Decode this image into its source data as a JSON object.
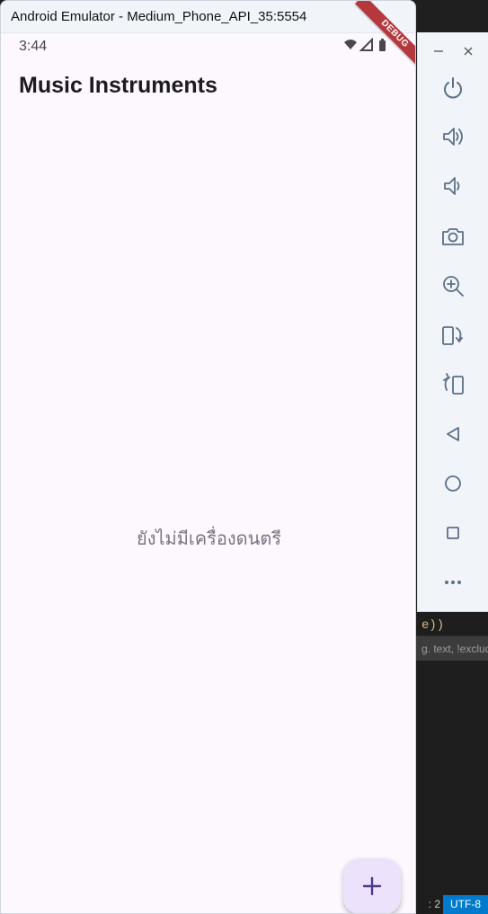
{
  "window": {
    "title": "Android Emulator - Medium_Phone_API_35:5554"
  },
  "status_bar": {
    "time": "3:44",
    "icons": [
      "wifi-icon",
      "cell-signal-icon",
      "battery-icon"
    ]
  },
  "app": {
    "title": "Music Instruments",
    "empty_message": "ยังไม่มีเครื่องดนตรี",
    "debug_banner": "DEBUG",
    "fab_icon": "add-icon"
  },
  "toolbar": {
    "window_controls": [
      "minimize-icon",
      "close-icon"
    ],
    "buttons": [
      {
        "name": "power-button",
        "icon": "power-icon"
      },
      {
        "name": "volume-up-button",
        "icon": "volume-up-icon"
      },
      {
        "name": "volume-down-button",
        "icon": "volume-down-icon"
      },
      {
        "name": "screenshot-button",
        "icon": "camera-icon"
      },
      {
        "name": "zoom-button",
        "icon": "zoom-in-icon"
      },
      {
        "name": "rotate-left-button",
        "icon": "rotate-left-icon"
      },
      {
        "name": "rotate-right-button",
        "icon": "rotate-right-icon"
      },
      {
        "name": "back-button",
        "icon": "back-triangle-icon"
      },
      {
        "name": "home-button",
        "icon": "home-circle-icon"
      },
      {
        "name": "overview-button",
        "icon": "overview-square-icon"
      },
      {
        "name": "more-button",
        "icon": "more-dots-icon"
      }
    ]
  },
  "background_editor": {
    "code_fragment": "e))",
    "search_placeholder": "g. text, !exclud",
    "cursor_position": ": 2",
    "encoding": "UTF-8"
  },
  "colors": {
    "app_background": "#fdf7fe",
    "title_text": "#1d1b20",
    "fab_background": "#ece2fb",
    "fab_icon": "#4f378b",
    "debug_ribbon": "#b5383c",
    "toolbar_icon": "#5b7087",
    "status_bar_accent": "#007acc"
  }
}
